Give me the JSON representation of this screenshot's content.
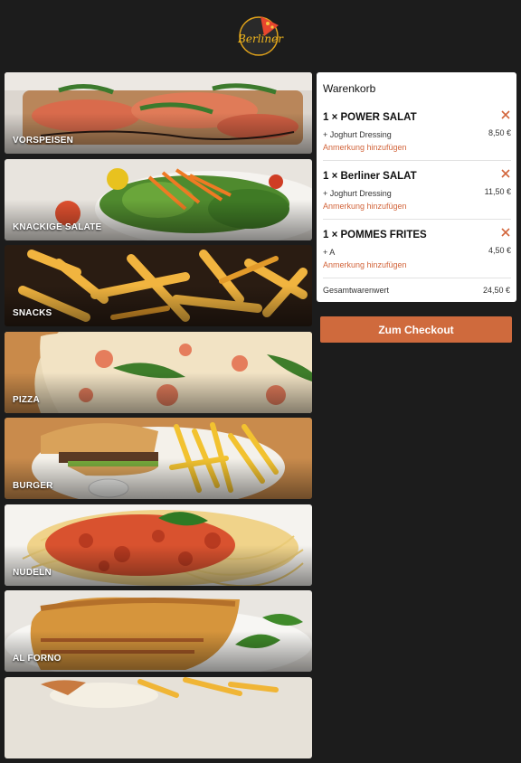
{
  "brand": {
    "logo_text": "Berliner"
  },
  "categories": [
    {
      "label": "VORSPEISEN"
    },
    {
      "label": "KNACKIGE SALATE"
    },
    {
      "label": "SNACKS"
    },
    {
      "label": "PIZZA"
    },
    {
      "label": "BURGER"
    },
    {
      "label": "NUDELN"
    },
    {
      "label": "AL FORNO"
    },
    {
      "label": ""
    }
  ],
  "cart": {
    "title": "Warenkorb",
    "items": [
      {
        "name": "1 × POWER SALAT",
        "option": "+ Joghurt Dressing",
        "price": "8,50 €",
        "note_link": "Anmerkung hinzufügen"
      },
      {
        "name": "1 × Berliner SALAT",
        "option": "+ Joghurt Dressing",
        "price": "11,50 €",
        "note_link": "Anmerkung hinzufügen"
      },
      {
        "name": "1 × POMMES FRITES",
        "option": "+ A",
        "price": "4,50 €",
        "note_link": "Anmerkung hinzufügen"
      }
    ],
    "total_label": "Gesamtwarenwert",
    "total_value": "24,50 €"
  },
  "checkout": {
    "label": "Zum Checkout"
  },
  "colors": {
    "accent": "#cf6a3d",
    "remove_icon": "#d2643a",
    "background": "#1c1c1c"
  }
}
